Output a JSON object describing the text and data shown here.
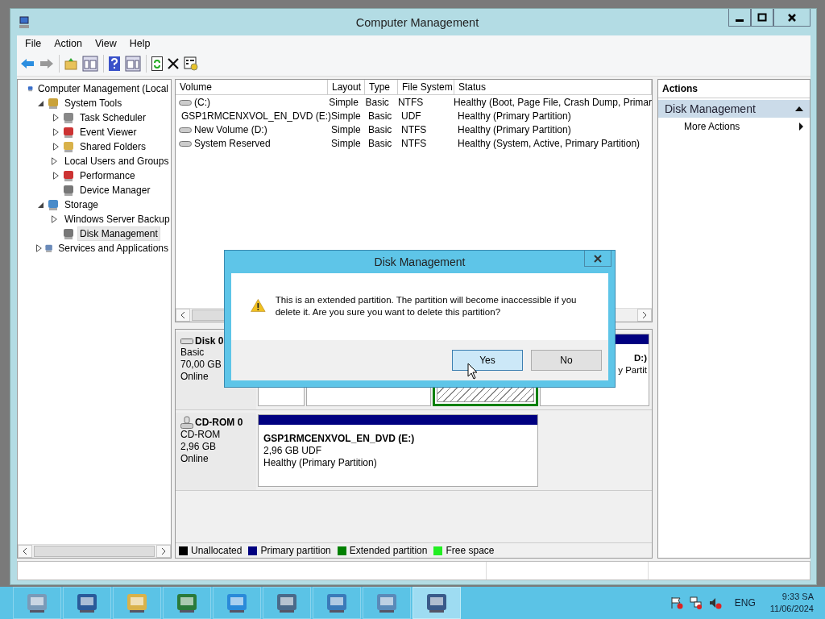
{
  "window": {
    "title": "Computer Management"
  },
  "menu": [
    "File",
    "Action",
    "View",
    "Help"
  ],
  "tree": [
    {
      "label": "Computer Management (Local",
      "selected": false,
      "children": [
        {
          "label": "System Tools",
          "expanded": true,
          "selected": false,
          "children": [
            {
              "label": "Task Scheduler",
              "expanded": false,
              "selected": false
            },
            {
              "label": "Event Viewer",
              "expanded": false,
              "selected": false
            },
            {
              "label": "Shared Folders",
              "expanded": false,
              "selected": false
            },
            {
              "label": "Local Users and Groups",
              "expanded": false,
              "selected": false
            },
            {
              "label": "Performance",
              "expanded": false,
              "selected": false
            },
            {
              "label": "Device Manager",
              "selected": false
            }
          ]
        },
        {
          "label": "Storage",
          "expanded": true,
          "selected": false,
          "children": [
            {
              "label": "Windows Server Backup",
              "expanded": false,
              "selected": false
            },
            {
              "label": "Disk Management",
              "selected": true
            }
          ]
        },
        {
          "label": "Services and Applications",
          "expanded": false,
          "selected": false
        }
      ]
    }
  ],
  "volumes": {
    "columns": [
      "Volume",
      "Layout",
      "Type",
      "File System",
      "Status"
    ],
    "rows": [
      {
        "kind": "drive",
        "cells": [
          "(C:)",
          "Simple",
          "Basic",
          "NTFS",
          "Healthy (Boot, Page File, Crash Dump, Primar"
        ]
      },
      {
        "kind": "cdrom",
        "cells": [
          "GSP1RMCENXVOL_EN_DVD (E:)",
          "Simple",
          "Basic",
          "UDF",
          "Healthy (Primary Partition)"
        ]
      },
      {
        "kind": "drive",
        "cells": [
          "New Volume (D:)",
          "Simple",
          "Basic",
          "NTFS",
          "Healthy (Primary Partition)"
        ]
      },
      {
        "kind": "drive",
        "cells": [
          "System Reserved",
          "Simple",
          "Basic",
          "NTFS",
          "Healthy (System, Active, Primary Partition)"
        ]
      }
    ]
  },
  "disks": [
    {
      "kind": "disk",
      "name": "Disk 0",
      "type": "Basic",
      "size": "70,00 GB",
      "status": "Online",
      "partitions": [
        {
          "kind": "primary"
        },
        {
          "kind": "primary"
        },
        {
          "kind": "extended"
        },
        {
          "kind": "primary",
          "title": "D:)",
          "lines": [
            "y Partit"
          ]
        }
      ]
    },
    {
      "kind": "cdrom",
      "name": "CD-ROM 0",
      "type": "CD-ROM",
      "size": "2,96 GB",
      "status": "Online",
      "partitions": [
        {
          "kind": "primary",
          "title": "GSP1RMCENXVOL_EN_DVD  (E:)",
          "lines": [
            "2,96 GB UDF",
            "Healthy (Primary Partition)"
          ]
        }
      ]
    }
  ],
  "legend": [
    {
      "label": "Unallocated",
      "color": "#000000"
    },
    {
      "label": "Primary partition",
      "color": "#000080"
    },
    {
      "label": "Extended partition",
      "color": "#008000"
    },
    {
      "label": "Free space",
      "color": "#22ee22"
    }
  ],
  "actions": {
    "header": "Actions",
    "section": {
      "label": "Disk Management",
      "expanded": true
    },
    "items": [
      "More Actions"
    ]
  },
  "dialog": {
    "title": "Disk Management",
    "message": "This is an extended partition. The partition will become inaccessible if you delete it. Are you sure you want to delete this partition?",
    "buttons": [
      {
        "label": "Yes",
        "selected": true
      },
      {
        "label": "No",
        "selected": false
      }
    ]
  },
  "taskbar": [
    {
      "active": false
    },
    {
      "active": false
    },
    {
      "active": false
    },
    {
      "active": false
    },
    {
      "active": false
    },
    {
      "active": false
    },
    {
      "active": false
    },
    {
      "active": false
    },
    {
      "active": true
    }
  ],
  "tray": {
    "language": "ENG",
    "time": "9:33 SA",
    "date": "11/06/2024"
  }
}
